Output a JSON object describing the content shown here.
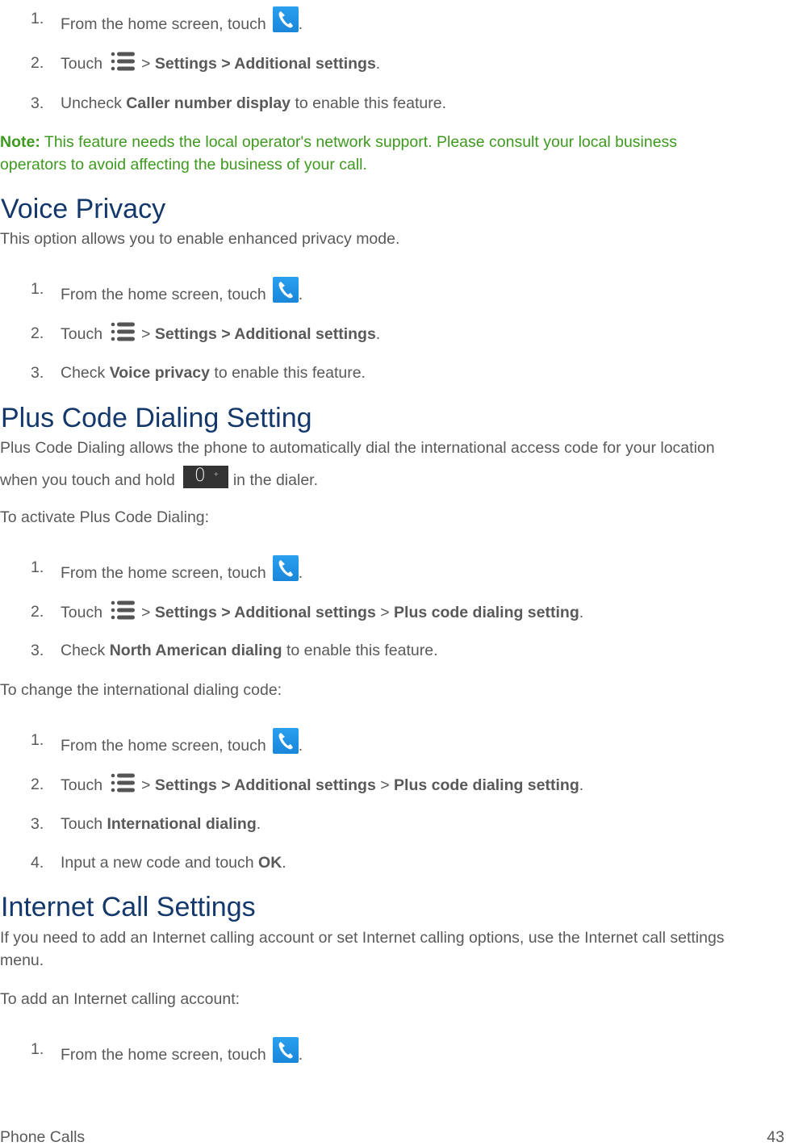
{
  "icons": {
    "phone": "phone-icon",
    "menu": "menu-icon",
    "zero_key": {
      "digit": "0",
      "sub": "+"
    }
  },
  "colors": {
    "heading": "#14386b",
    "body_text": "#595959",
    "note": "#3d9a1e",
    "phone_icon_bg": "#2196e8",
    "zero_key_bg": "#333333"
  },
  "caller_steps": [
    {
      "num": "1.",
      "pre": "From the home screen, touch",
      "post": "."
    },
    {
      "num": "2.",
      "pre": "Touch",
      "sep1": ">",
      "b1": "Settings > Additional settings",
      "post": "."
    },
    {
      "num": "3.",
      "pre": "Uncheck",
      "b1": "Caller number display",
      "post": "to enable this feature."
    }
  ],
  "note": {
    "label": "Note:",
    "line1": "This feature needs the local operator's network support. Please consult your local business",
    "line2": "operators to avoid affecting the business of your call."
  },
  "voice_privacy": {
    "title": "Voice Privacy",
    "intro": "This option allows you to enable enhanced privacy mode.",
    "steps": [
      {
        "num": "1.",
        "pre": "From the home screen, touch",
        "post": "."
      },
      {
        "num": "2.",
        "pre": "Touch",
        "sep1": ">",
        "b1": "Settings > Additional settings",
        "post": "."
      },
      {
        "num": "3.",
        "pre": "Check",
        "b1": "Voice privacy",
        "post": "to enable this feature."
      }
    ]
  },
  "plus_code": {
    "title": "Plus Code Dialing Setting",
    "intro_line1": "Plus Code Dialing allows the phone to automatically dial the international access code for your location",
    "intro_line2_pre": "when you touch and hold",
    "intro_line2_post": "in the dialer.",
    "activate_label": "To activate Plus Code Dialing:",
    "activate_steps": [
      {
        "num": "1.",
        "pre": "From the home screen, touch",
        "post": "."
      },
      {
        "num": "2.",
        "pre": "Touch",
        "sep1": ">",
        "b1": "Settings > Additional settings",
        "sep2": ">",
        "b2": "Plus code dialing setting",
        "post": "."
      },
      {
        "num": "3.",
        "pre": "Check",
        "b1": "North American dialing",
        "post": "to enable this feature."
      }
    ],
    "change_label": "To change the international dialing code:",
    "change_steps": [
      {
        "num": "1.",
        "pre": "From the home screen, touch",
        "post": "."
      },
      {
        "num": "2.",
        "pre": "Touch",
        "sep1": ">",
        "b1": "Settings > Additional settings",
        "sep2": ">",
        "b2": "Plus code dialing setting",
        "post": "."
      },
      {
        "num": "3.",
        "pre": "Touch",
        "b1": "International dialing",
        "post": "."
      },
      {
        "num": "4.",
        "pre": "Input a new code and touch",
        "b1": "OK",
        "post": "."
      }
    ]
  },
  "internet_call": {
    "title": "Internet Call Settings",
    "intro_line1": "If you need to add an Internet calling account or set Internet calling options, use the Internet call settings",
    "intro_line2": "menu.",
    "add_label": "To add an Internet calling account:",
    "steps": [
      {
        "num": "1.",
        "pre": "From the home screen, touch",
        "post": "."
      }
    ]
  },
  "footer": {
    "section": "Phone Calls",
    "page": "43"
  }
}
